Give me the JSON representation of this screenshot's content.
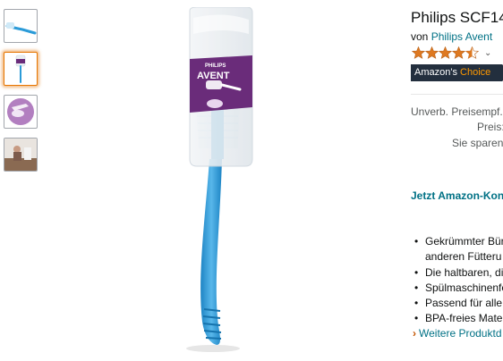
{
  "product": {
    "title": "Philips SCF14",
    "by_prefix": "von",
    "brand_link": "Philips Avent",
    "rating": 4.5,
    "rating_chevron": "⌄",
    "badge": {
      "label_1": "Amazon's",
      "label_2": "Choice"
    }
  },
  "prices": {
    "list_price_label": "Unverb. Preisempf.:",
    "price_label": "Preis:",
    "savings_label": "Sie sparen:"
  },
  "promo_link": "Jetzt Amazon-Kont",
  "bullets": [
    "Gekrümmter Bür",
    "anderen Fütteru",
    "Die haltbaren, di",
    "Spülmaschinenfe",
    "Passend für alle",
    "BPA-freies Mater"
  ],
  "more_link": "Weitere Produktd",
  "bottom_cut_text": "           ",
  "image_text": {
    "brand_top": "PHILIPS",
    "brand_main": "AVENT"
  },
  "colors": {
    "link": "#007185",
    "badge_bg": "#232f3e",
    "badge_accent": "#ff9900",
    "star": "#de7921",
    "brush": "#2b9bd8"
  }
}
